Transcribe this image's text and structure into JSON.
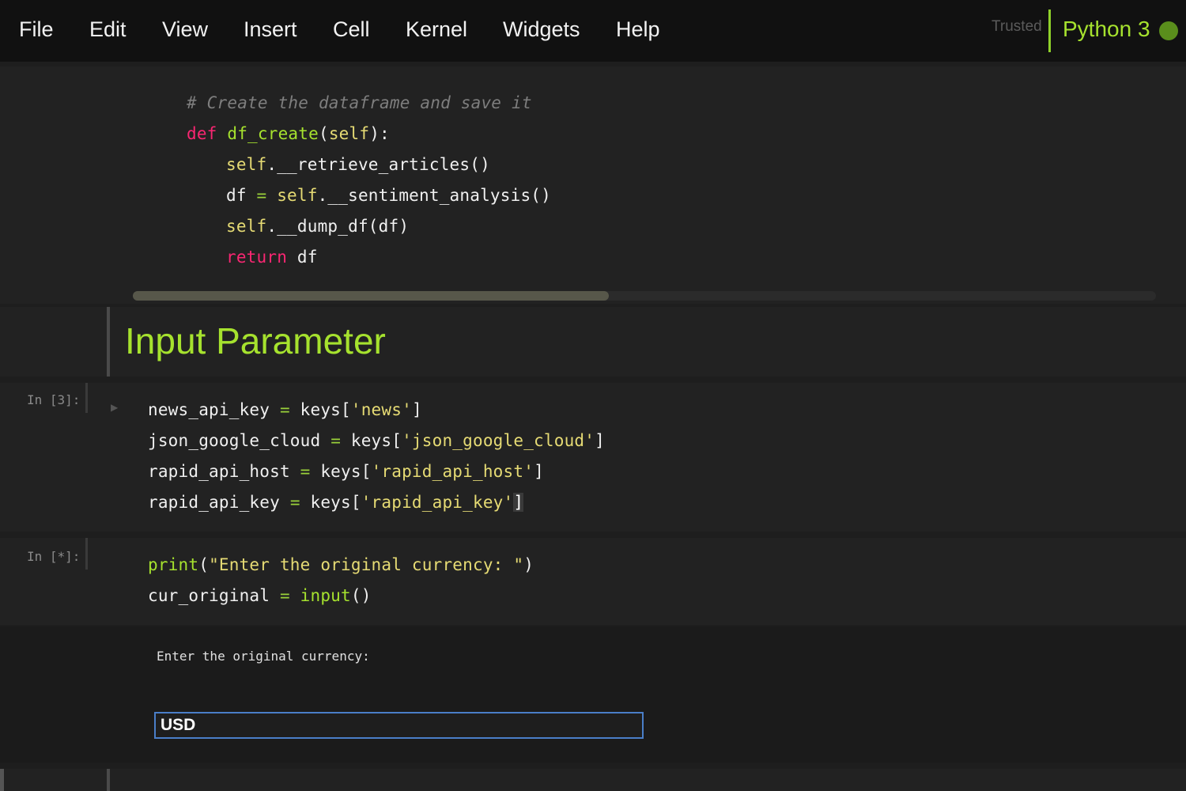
{
  "menu": {
    "file": "File",
    "edit": "Edit",
    "view": "View",
    "insert": "Insert",
    "cell": "Cell",
    "kernel": "Kernel",
    "widgets": "Widgets",
    "help": "Help"
  },
  "status": {
    "trusted": "Trusted",
    "kernel_name": "Python 3"
  },
  "cell_top": {
    "comment": "# Create the dataframe and save it",
    "def_kw": "def",
    "func_name": "df_create",
    "self_param": "self",
    "line2_self": "self",
    "line2_rest": ".__retrieve_articles()",
    "line3_df": "df",
    "line3_eq": "=",
    "line3_self": "self",
    "line3_rest": ".__sentiment_analysis()",
    "line4_self": "self",
    "line4_rest": ".__dump_df(df)",
    "return_kw": "return",
    "return_val": "df"
  },
  "markdown": {
    "heading": "Input Parameter"
  },
  "cell_3": {
    "prompt": "In [3]:",
    "rows": [
      {
        "var": "news_api_key",
        "eq": "=",
        "pre": "keys[",
        "str": "'news'",
        "post": "]"
      },
      {
        "var": "json_google_cloud",
        "eq": "=",
        "pre": "keys[",
        "str": "'json_google_cloud'",
        "post": "]"
      },
      {
        "var": "rapid_api_host",
        "eq": "=",
        "pre": "keys[",
        "str": "'rapid_api_host'",
        "post": "]"
      },
      {
        "var": "rapid_api_key",
        "eq": "=",
        "pre": "keys[",
        "str": "'rapid_api_key'",
        "post": "]"
      }
    ]
  },
  "cell_star": {
    "prompt": "In [*]:",
    "print_fn": "print",
    "print_str": "\"Enter the original currency: \"",
    "var": "cur_original",
    "eq": "=",
    "input_fn": "input",
    "input_args": "()"
  },
  "output": {
    "prompt_text": "Enter the original currency:",
    "input_value": "USD"
  }
}
